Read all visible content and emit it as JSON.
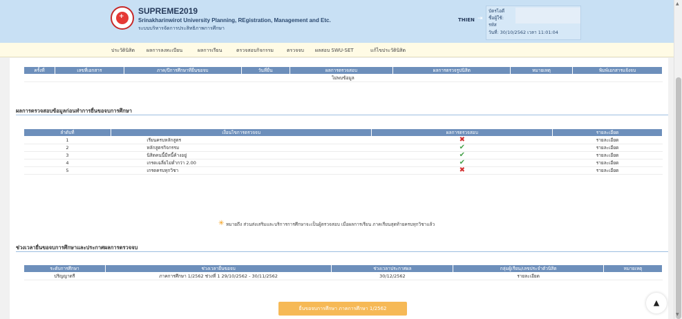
{
  "header": {
    "app_name": "SUPREME2019",
    "subtitle_en": "Srinakharinwirot University Planning, REgistration, Management and Etc.",
    "subtitle_th": "ระบบบริหารจัดการประสิทธิภาพการศึกษา",
    "username": "THIEN",
    "user_info": {
      "line1": "บัตรไอดี",
      "line2": "ชื่อผู้ใช้:",
      "line3": "รหัส",
      "datetime": "วันที่: 30/10/2562 เวลา 11:01:04"
    }
  },
  "nav": {
    "items": [
      "ประวัตินิสิต",
      "ผลการลงทะเบียน",
      "ผลการเรียน",
      "ตรวจสอบกิจกรรม",
      "ตรวจจบ",
      "ผลสอบ SWU-SET",
      "แก้ไขประวัตินิสิต"
    ]
  },
  "doc_table": {
    "headers": [
      "ครั้งที่",
      "เลขที่เอกสาร",
      "ภาค/ปีการศึกษาที่ยื่นขอจบ",
      "วันที่ยื่น",
      "ผลการตรวจสอบ",
      "ผลการตรวจรูปนิสิต",
      "หมายเหตุ",
      "พิมพ์เอกสารแจ้งจบ"
    ],
    "empty_text": "ไม่พบข้อมูล"
  },
  "check_section": {
    "title": "ผลการตรวจสอบข้อมูลก่อนทำการยื่นขอจบการศึกษา",
    "headers": [
      "ลำดับที่",
      "เงื่อนไขการตรวจจบ",
      "ผลการตรวจสอบ",
      "รายละเอียด"
    ],
    "rows": [
      {
        "no": "1",
        "condition": "เรียนครบหลักสูตร",
        "pass": false,
        "detail": "รายละเอียด"
      },
      {
        "no": "2",
        "condition": "หลักสูตรกิจกรรม",
        "pass": true,
        "detail": "รายละเอียด"
      },
      {
        "no": "3",
        "condition": "นิสิตคนนี้มีหนี้ค้างอยู่",
        "pass": true,
        "detail": "รายละเอียด"
      },
      {
        "no": "4",
        "condition": "เกรดเฉลี่ยไม่ต่ำกว่า 2.00",
        "pass": true,
        "detail": "รายละเอียด"
      },
      {
        "no": "5",
        "condition": "เกรดครบทุกวิชา",
        "pass": false,
        "detail": "รายละเอียด"
      }
    ],
    "icons": {
      "fail": "✖",
      "pass": "✔"
    },
    "note": "หมายถึง ส่วนส่งเสริมและบริการการศึกษาจะเป็นผู้ตรวจสอบ เมื่อผลการเรียน ภาคเรียนสุดท้ายครบทุกวิชาแล้ว"
  },
  "schedule_section": {
    "title": "ช่วงเวลายื่นขอจบการศึกษาและประกาศผลการตรวจจบ",
    "headers": [
      "ระดับการศึกษา",
      "ช่วงเวลายื่นขอจบ",
      "ช่วงเวลาประกาศผล",
      "กลุ่มผู้เรียน/เลขประจำตัวนิสิต",
      "หมายเหตุ"
    ],
    "rows": [
      {
        "level": "ปริญญาตรี",
        "period": "ภาคการศึกษา 1/2562 ช่วงที่ 1 29/10/2562 - 30/11/2562",
        "announce": "30/12/2562",
        "group": "รายละเอียด",
        "note": ""
      }
    ]
  },
  "submit_button": "ยื่นขอจบการศึกษา ภาคการศึกษา 1/2562",
  "colors": {
    "header_bg": "#c8e0f4",
    "table_head": "#6d8fbb",
    "button": "#f6b956",
    "fail": "#d32f2f",
    "pass": "#43a047"
  }
}
